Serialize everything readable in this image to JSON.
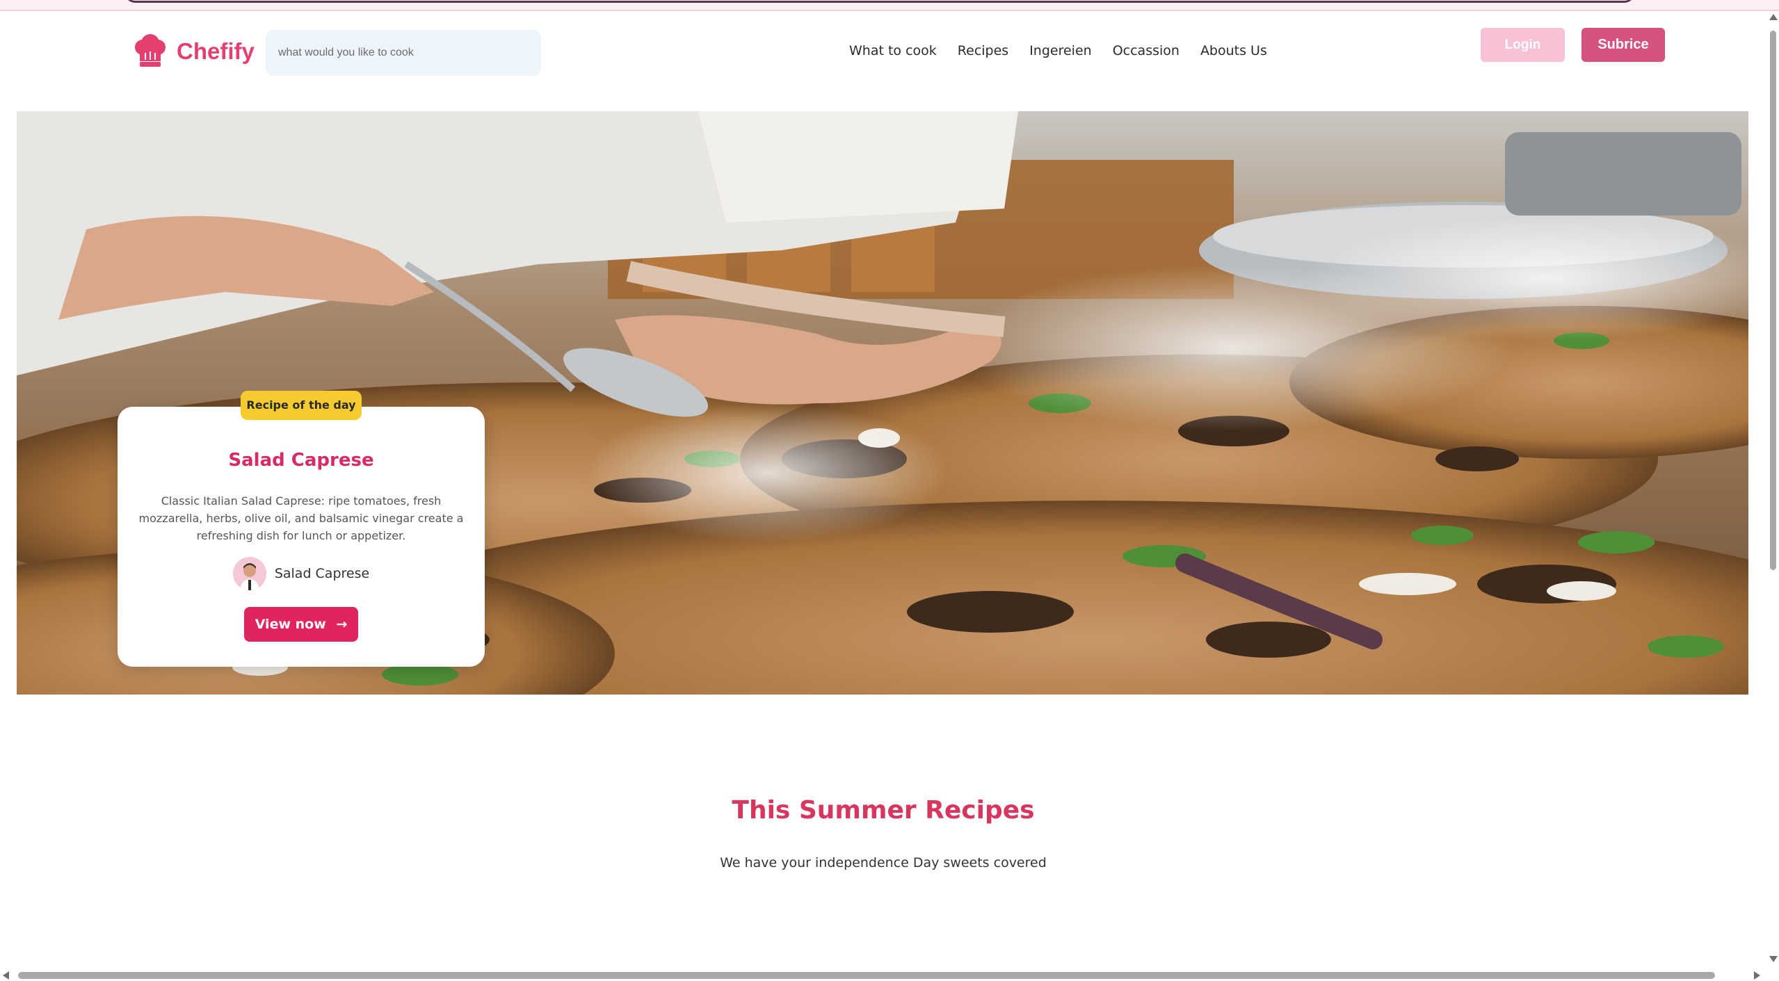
{
  "brand": {
    "name": "Chefify",
    "logo_icon": "chef-hat-icon",
    "color": "#e4406f"
  },
  "search": {
    "placeholder": "what would you like to cook"
  },
  "nav": {
    "items": [
      {
        "label": "What to cook"
      },
      {
        "label": "Recipes"
      },
      {
        "label": "Ingereien"
      },
      {
        "label": "Occassion"
      },
      {
        "label": "Abouts Us"
      }
    ]
  },
  "actions": {
    "login_label": "Login",
    "subscribe_label": "Subrice"
  },
  "hero": {
    "badge": "Recipe of the day",
    "title": "Salad Caprese",
    "description": "Classic Italian Salad Caprese: ripe tomatoes, fresh mozzarella, herbs, olive oil, and balsamic vinegar create a refreshing dish for lunch or appetizer.",
    "author": "Salad Caprese",
    "cta_label": "View now",
    "cta_arrow": "→"
  },
  "section": {
    "title": "This Summer Recipes",
    "subtitle": "We have your independence Day sweets covered"
  },
  "colors": {
    "accent": "#e1235f",
    "badge": "#f7cb2f",
    "login_bg": "#f9c2d2",
    "subscribe_bg": "#d6527e"
  }
}
